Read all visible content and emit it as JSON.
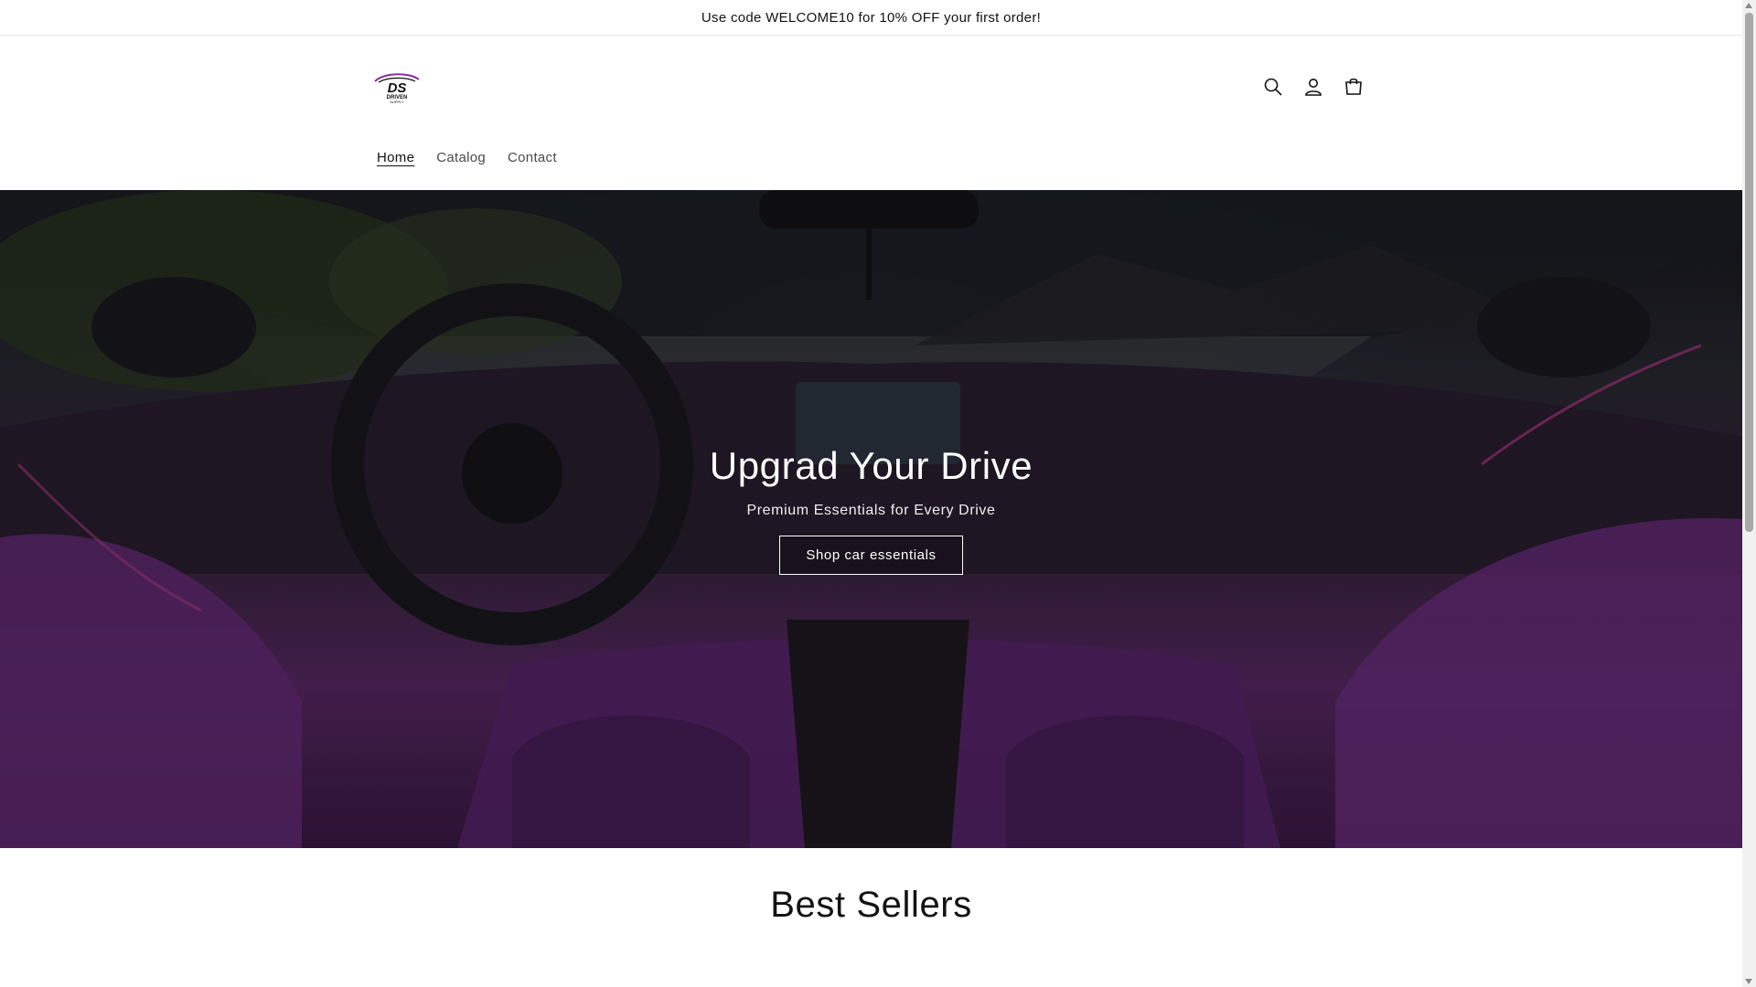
{
  "announcement": {
    "text": "Use code WELCOME10 for 10% OFF your first order!"
  },
  "header": {
    "logo": {
      "primary": "DS",
      "secondary": "DRIVEN",
      "tertiary": "SUPPLY"
    },
    "icons": [
      "search-icon",
      "account-icon",
      "cart-icon"
    ],
    "nav": [
      {
        "label": "Home",
        "active": true
      },
      {
        "label": "Catalog",
        "active": false
      },
      {
        "label": "Contact",
        "active": false
      }
    ]
  },
  "hero": {
    "title": "Upgrad Your Drive",
    "subtitle": "Premium Essentials for Every Drive",
    "button_label": "Shop car essentials"
  },
  "best_sellers": {
    "title": "Best Sellers"
  },
  "colors": {
    "accent": "#8e2aa8",
    "text": "#121212",
    "background": "#ffffff"
  }
}
